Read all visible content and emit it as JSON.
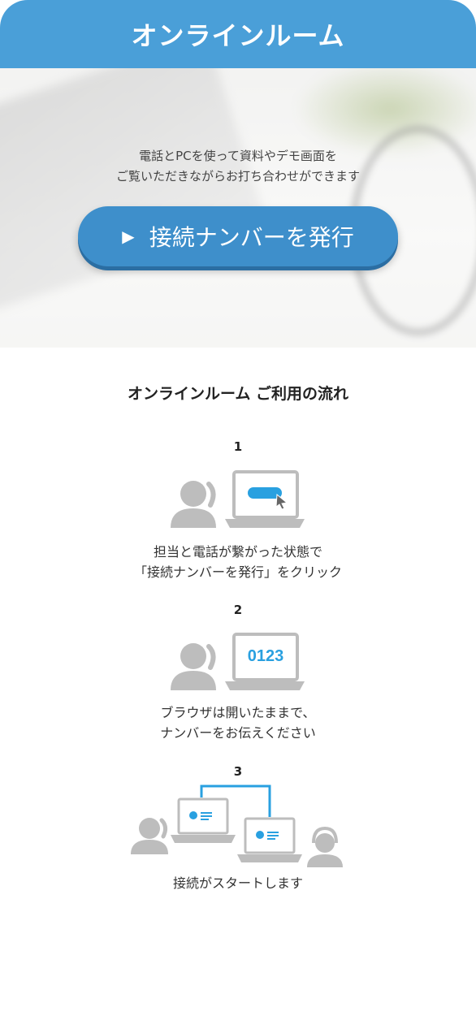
{
  "header": {
    "title": "オンラインルーム"
  },
  "hero": {
    "line1": "電話とPCを使って資料やデモ画面を",
    "line2": "ご覧いただきながらお打ち合わせができます",
    "button_label": "接続ナンバーを発行"
  },
  "flow": {
    "title": "オンラインルーム ご利用の流れ",
    "steps": [
      {
        "number": "1",
        "line1": "担当と電話が繋がった状態で",
        "line2": "「接続ナンバーを発行」をクリック"
      },
      {
        "number": "2",
        "screen_text": "0123",
        "line1": "ブラウザは開いたままで、",
        "line2": "ナンバーをお伝えください"
      },
      {
        "number": "3",
        "line1": "接続がスタートします"
      }
    ]
  },
  "colors": {
    "header": "#4a9fd8",
    "button": "#3e8fcb",
    "accent": "#29a0e0",
    "icon_gray": "#bdbdbd"
  },
  "icons": [
    "play-icon",
    "person-phone-icon",
    "laptop-icon",
    "cursor-icon",
    "headset-person-icon"
  ]
}
